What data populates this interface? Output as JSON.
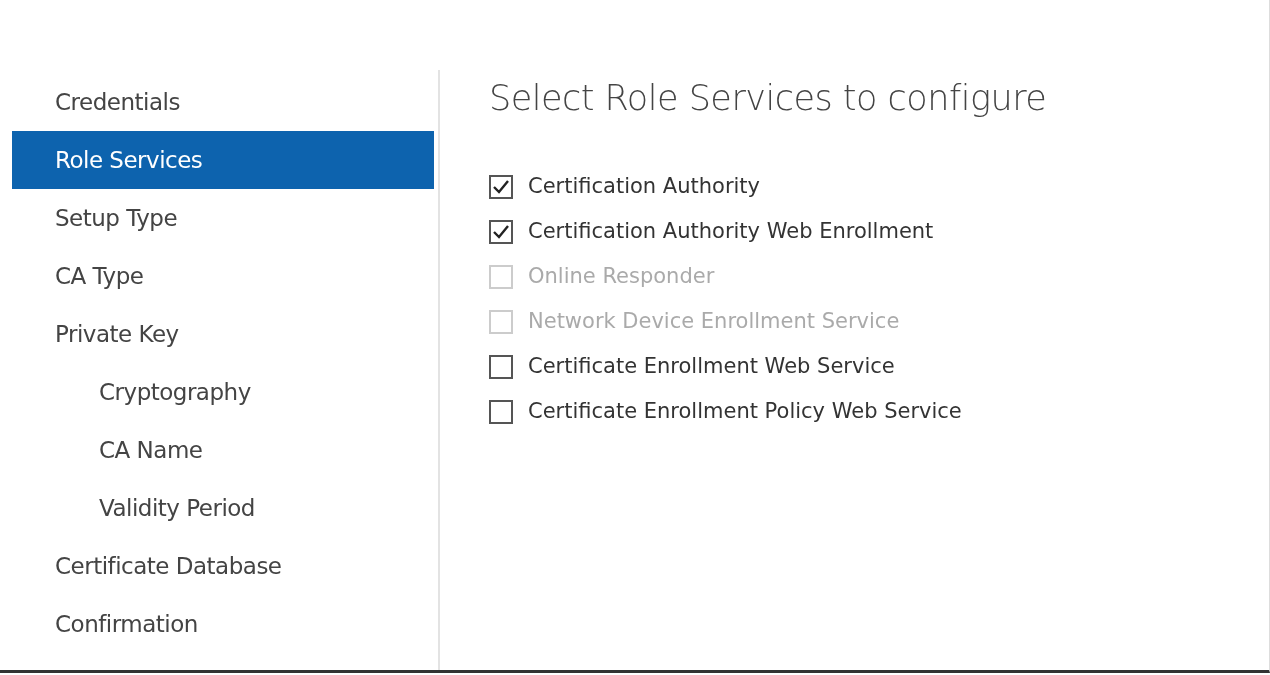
{
  "sidebar": {
    "items": [
      {
        "label": "Credentials",
        "selected": false
      },
      {
        "label": "Role Services",
        "selected": true
      },
      {
        "label": "Setup Type",
        "selected": false
      },
      {
        "label": "CA Type",
        "selected": false
      },
      {
        "label": "Private Key",
        "selected": false,
        "children": [
          {
            "label": "Cryptography",
            "selected": false
          },
          {
            "label": "CA Name",
            "selected": false
          },
          {
            "label": "Validity Period",
            "selected": false
          }
        ]
      },
      {
        "label": "Certificate Database",
        "selected": false
      },
      {
        "label": "Confirmation",
        "selected": false
      }
    ]
  },
  "content": {
    "title": "Select Role Services to configure",
    "role_services": [
      {
        "label": "Certification Authority",
        "checked": true,
        "disabled": false
      },
      {
        "label": "Certification Authority Web Enrollment",
        "checked": true,
        "disabled": false
      },
      {
        "label": "Online Responder",
        "checked": false,
        "disabled": true
      },
      {
        "label": "Network Device Enrollment Service",
        "checked": false,
        "disabled": true
      },
      {
        "label": "Certificate Enrollment Web Service",
        "checked": false,
        "disabled": false
      },
      {
        "label": "Certificate Enrollment Policy Web Service",
        "checked": false,
        "disabled": false
      }
    ]
  }
}
